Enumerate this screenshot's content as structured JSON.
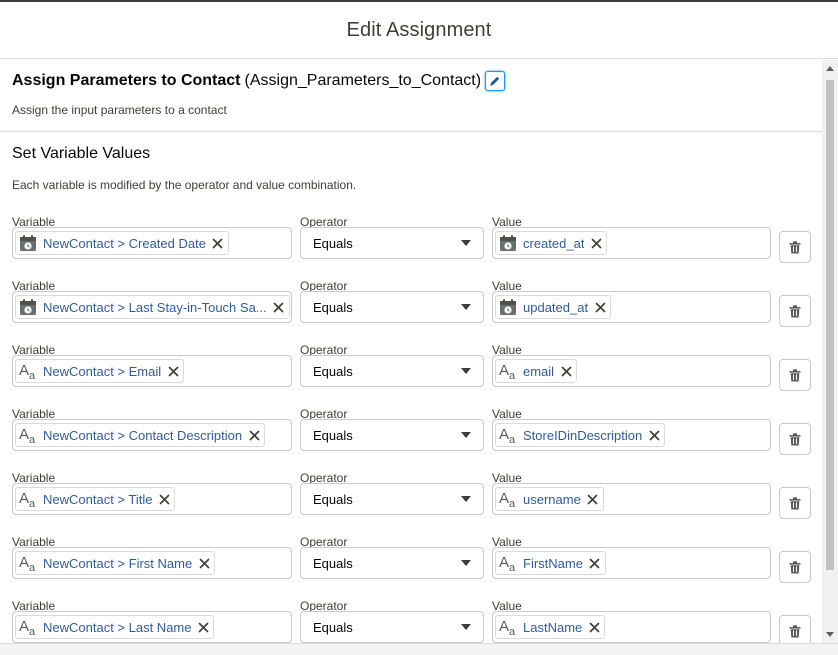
{
  "modal": {
    "title": "Edit Assignment"
  },
  "element": {
    "label": "Assign Parameters to Contact",
    "api_name": "(Assign_Parameters_to_Contact)",
    "description": "Assign the input parameters to a contact"
  },
  "section": {
    "title": "Set Variable Values",
    "description": "Each variable is modified by the operator and value combination."
  },
  "column_labels": {
    "variable": "Variable",
    "operator": "Operator",
    "value": "Value"
  },
  "rows": [
    {
      "variable": "NewContact > Created Date",
      "variable_icon": "calendar-icon",
      "operator": "Equals",
      "value": "created_at",
      "value_icon": "calendar-icon"
    },
    {
      "variable": "NewContact > Last Stay-in-Touch Sa...",
      "variable_icon": "calendar-icon",
      "operator": "Equals",
      "value": "updated_at",
      "value_icon": "calendar-icon"
    },
    {
      "variable": "NewContact > Email",
      "variable_icon": "text-icon",
      "operator": "Equals",
      "value": "email",
      "value_icon": "text-icon"
    },
    {
      "variable": "NewContact > Contact Description",
      "variable_icon": "text-icon",
      "operator": "Equals",
      "value": "StoreIDinDescription",
      "value_icon": "text-icon"
    },
    {
      "variable": "NewContact > Title",
      "variable_icon": "text-icon",
      "operator": "Equals",
      "value": "username",
      "value_icon": "text-icon"
    },
    {
      "variable": "NewContact > First Name",
      "variable_icon": "text-icon",
      "operator": "Equals",
      "value": "FirstName",
      "value_icon": "text-icon"
    },
    {
      "variable": "NewContact > Last Name",
      "variable_icon": "text-icon",
      "operator": "Equals",
      "value": "LastName",
      "value_icon": "text-icon"
    }
  ],
  "colors": {
    "link": "#2e5c9e",
    "border": "#c9c9c9",
    "focus": "#1b96ff"
  }
}
